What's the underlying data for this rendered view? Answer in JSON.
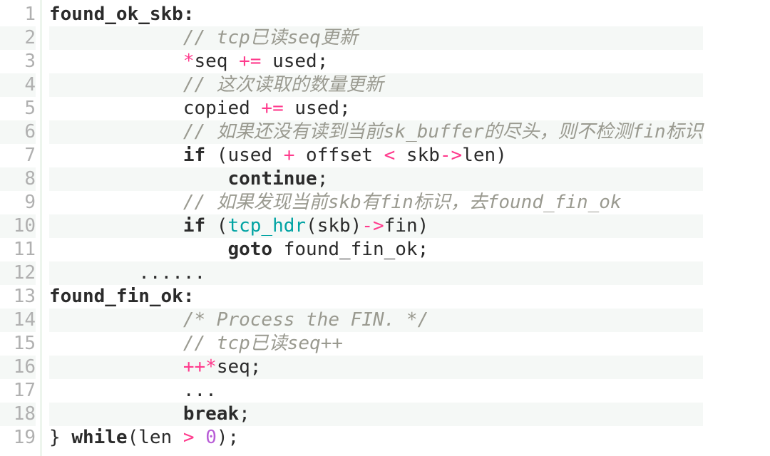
{
  "language": "c",
  "colors": {
    "gutter_fg": "#b0b0b0",
    "gutter_rule": "#edf5ed",
    "row_alt_bg": "#f5f8f6",
    "operator": "#ff3b8d",
    "function": "#00a3a3",
    "number": "#b85cd6",
    "comment": "#9a9a90"
  },
  "lines": [
    {
      "n": 1,
      "indent": 0,
      "tokens": [
        {
          "t": "found_ok_skb:",
          "c": "c-label"
        }
      ]
    },
    {
      "n": 2,
      "indent": 12,
      "tokens": [
        {
          "t": "// tcp已读seq更新",
          "c": "c-comment"
        }
      ]
    },
    {
      "n": 3,
      "indent": 12,
      "tokens": [
        {
          "t": "*",
          "c": "c-op"
        },
        {
          "t": "seq ",
          "c": "c-default"
        },
        {
          "t": "+=",
          "c": "c-op"
        },
        {
          "t": " used;",
          "c": "c-default"
        }
      ]
    },
    {
      "n": 4,
      "indent": 12,
      "tokens": [
        {
          "t": "// 这次读取的数量更新",
          "c": "c-comment"
        }
      ]
    },
    {
      "n": 5,
      "indent": 12,
      "tokens": [
        {
          "t": "copied ",
          "c": "c-default"
        },
        {
          "t": "+=",
          "c": "c-op"
        },
        {
          "t": " used;",
          "c": "c-default"
        }
      ]
    },
    {
      "n": 6,
      "indent": 12,
      "tokens": [
        {
          "t": "// 如果还没有读到当前sk_buffer的尽头，则不检测fin标识",
          "c": "c-comment"
        }
      ]
    },
    {
      "n": 7,
      "indent": 12,
      "tokens": [
        {
          "t": "if",
          "c": "c-kw"
        },
        {
          "t": " (used ",
          "c": "c-default"
        },
        {
          "t": "+",
          "c": "c-op"
        },
        {
          "t": " offset ",
          "c": "c-default"
        },
        {
          "t": "<",
          "c": "c-op"
        },
        {
          "t": " skb",
          "c": "c-default"
        },
        {
          "t": "->",
          "c": "c-op"
        },
        {
          "t": "len)",
          "c": "c-default"
        }
      ]
    },
    {
      "n": 8,
      "indent": 16,
      "tokens": [
        {
          "t": "continue",
          "c": "c-kw"
        },
        {
          "t": ";",
          "c": "c-default"
        }
      ]
    },
    {
      "n": 9,
      "indent": 12,
      "tokens": [
        {
          "t": "// 如果发现当前skb有fin标识，去found_fin_ok",
          "c": "c-comment"
        }
      ]
    },
    {
      "n": 10,
      "indent": 12,
      "tokens": [
        {
          "t": "if",
          "c": "c-kw"
        },
        {
          "t": " (",
          "c": "c-default"
        },
        {
          "t": "tcp_hdr",
          "c": "c-fn"
        },
        {
          "t": "(skb)",
          "c": "c-default"
        },
        {
          "t": "->",
          "c": "c-op"
        },
        {
          "t": "fin)",
          "c": "c-default"
        }
      ]
    },
    {
      "n": 11,
      "indent": 16,
      "tokens": [
        {
          "t": "goto",
          "c": "c-kw"
        },
        {
          "t": " found_fin_ok;",
          "c": "c-default"
        }
      ]
    },
    {
      "n": 12,
      "indent": 8,
      "tokens": [
        {
          "t": "......",
          "c": "c-default"
        }
      ]
    },
    {
      "n": 13,
      "indent": 0,
      "tokens": [
        {
          "t": "found_fin_ok:",
          "c": "c-label"
        }
      ]
    },
    {
      "n": 14,
      "indent": 12,
      "tokens": [
        {
          "t": "/* Process the FIN. */",
          "c": "c-comment"
        }
      ]
    },
    {
      "n": 15,
      "indent": 12,
      "tokens": [
        {
          "t": "// tcp已读seq++",
          "c": "c-comment"
        }
      ]
    },
    {
      "n": 16,
      "indent": 12,
      "tokens": [
        {
          "t": "++*",
          "c": "c-op"
        },
        {
          "t": "seq;",
          "c": "c-default"
        }
      ]
    },
    {
      "n": 17,
      "indent": 12,
      "tokens": [
        {
          "t": "...",
          "c": "c-default"
        }
      ]
    },
    {
      "n": 18,
      "indent": 12,
      "tokens": [
        {
          "t": "break",
          "c": "c-kw"
        },
        {
          "t": ";",
          "c": "c-default"
        }
      ]
    },
    {
      "n": 19,
      "indent": 0,
      "tokens": [
        {
          "t": "} ",
          "c": "c-default"
        },
        {
          "t": "while",
          "c": "c-kw"
        },
        {
          "t": "(len ",
          "c": "c-default"
        },
        {
          "t": ">",
          "c": "c-op"
        },
        {
          "t": " ",
          "c": "c-default"
        },
        {
          "t": "0",
          "c": "c-num"
        },
        {
          "t": ");",
          "c": "c-default"
        }
      ]
    }
  ]
}
